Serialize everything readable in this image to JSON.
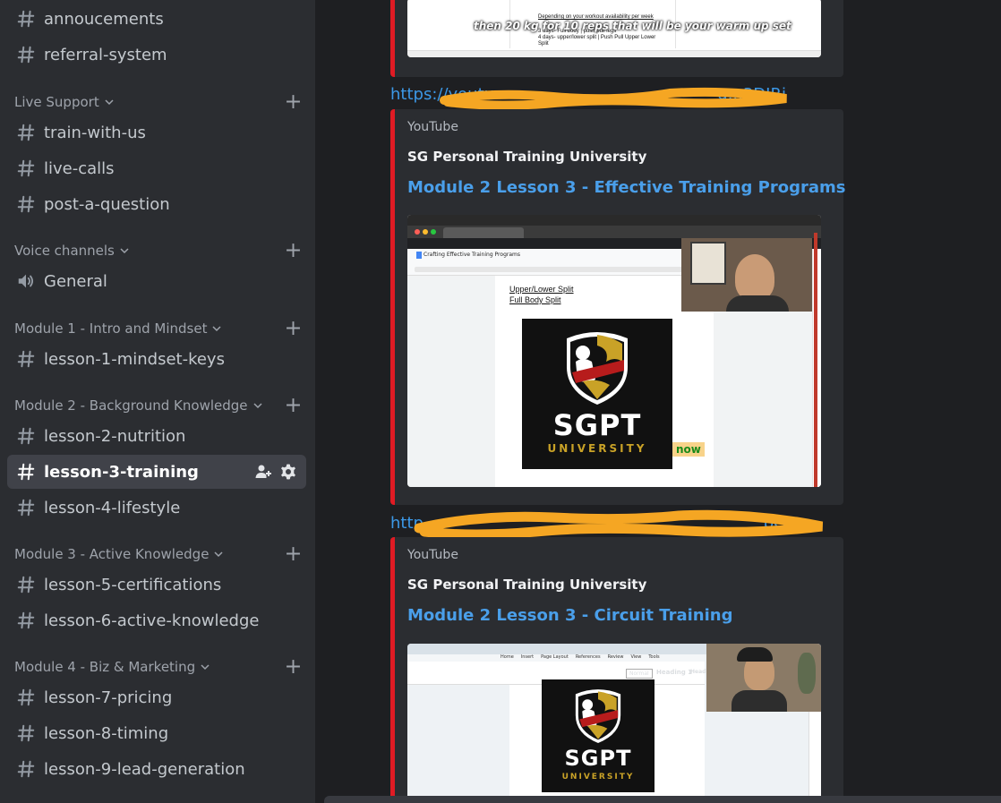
{
  "sidebar": {
    "channels_top": [
      {
        "label": "annoucements"
      },
      {
        "label": "referral-system"
      }
    ],
    "categories": [
      {
        "label": "Live Support",
        "channels": [
          {
            "label": "train-with-us"
          },
          {
            "label": "live-calls"
          },
          {
            "label": "post-a-question"
          }
        ]
      },
      {
        "label": "Voice channels",
        "channels": [
          {
            "label": "General"
          }
        ]
      },
      {
        "label": "Module 1 - Intro and Mindset",
        "channels": [
          {
            "label": "lesson-1-mindset-keys"
          }
        ]
      },
      {
        "label": "Module 2 - Background Knowledge",
        "channels": [
          {
            "label": "lesson-2-nutrition"
          },
          {
            "label": "lesson-3-training"
          },
          {
            "label": "lesson-4-lifestyle"
          }
        ]
      },
      {
        "label": "Module 3 - Active Knowledge",
        "channels": [
          {
            "label": "lesson-5-certifications"
          },
          {
            "label": "lesson-6-active-knowledge"
          }
        ]
      },
      {
        "label": "Module 4 - Biz & Marketing",
        "channels": [
          {
            "label": "lesson-7-pricing"
          },
          {
            "label": "lesson-8-timing"
          },
          {
            "label": "lesson-9-lead-generation"
          }
        ]
      }
    ],
    "active_channel": "lesson-3-training"
  },
  "chat": {
    "top_embed": {
      "doc_lines": [
        "Depending on your workout availability per week",
        "3 days- Full body | push pull legs",
        "4 days- upper/lower split | Push Pull Upper Lower",
        "Split"
      ],
      "caption": "then 20 kg for 10 reps that will be your warm up set"
    },
    "link1": "https://youtu",
    "link1_tail": "g...3DJRi",
    "embed1": {
      "provider": "YouTube",
      "author": "SG Personal Training University",
      "title": "Module 2 Lesson 3 - Effective Training Programs",
      "doc_title": "Crafting Effective Training Programs",
      "doc_lines": [
        "Upper/Lower Split",
        "Full Body Split"
      ],
      "highlight": "now"
    },
    "link2": "http",
    "link2_tail": "bG",
    "embed2": {
      "provider": "YouTube",
      "author": "SG Personal Training University",
      "title": "Module 2 Lesson 3 - Circuit Training",
      "doc_ribbon": [
        "Home",
        "Insert",
        "Page Layout",
        "References",
        "Review",
        "View",
        "Tools"
      ],
      "styles": [
        "Normal",
        "Heading 1",
        "Heading"
      ]
    },
    "logo": {
      "name": "SGPT",
      "sub": "UNIVERSITY"
    }
  },
  "colors": {
    "accent": "#4a9fea",
    "embed_border": "#e01b24",
    "scribble": "#f5a623",
    "logo_gold": "#c9a227"
  }
}
